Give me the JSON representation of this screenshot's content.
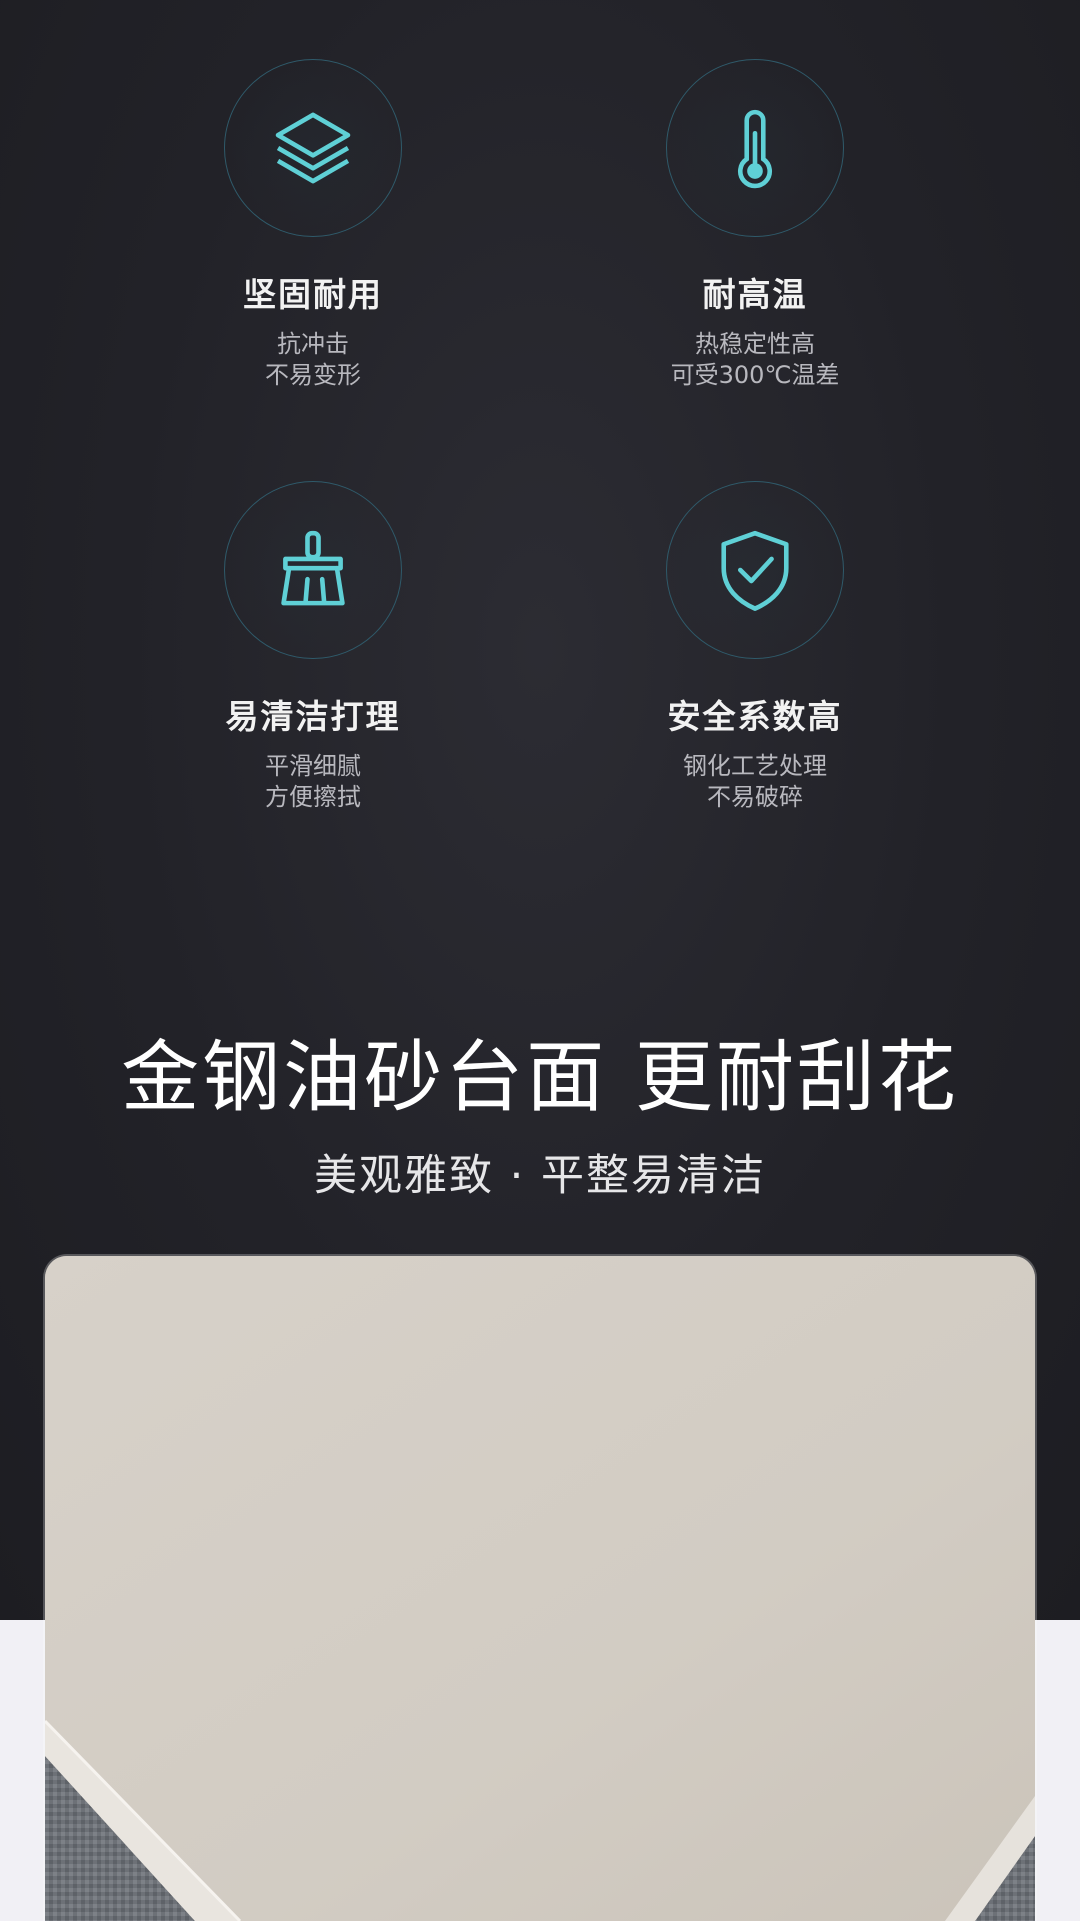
{
  "features": [
    {
      "title": "坚固耐用",
      "desc": [
        "抗冲击",
        "不易变形"
      ],
      "icon": "layers-icon"
    },
    {
      "title": "耐高温",
      "desc": [
        "热稳定性高",
        "可受300℃温差"
      ],
      "icon": "thermometer-icon"
    },
    {
      "title": "易清洁打理",
      "desc": [
        "平滑细腻",
        "方便擦拭"
      ],
      "icon": "brush-icon"
    },
    {
      "title": "安全系数高",
      "desc": [
        "钢化工艺处理",
        "不易破碎"
      ],
      "icon": "shield-check-icon"
    }
  ],
  "headline": "金钢油砂台面 更耐刮花",
  "subline": "美观雅致 · 平整易清洁",
  "colors": {
    "icon_accent": "#5fd0d6",
    "background_dark": "#222228",
    "panel_surface": "#d5cfc7"
  }
}
